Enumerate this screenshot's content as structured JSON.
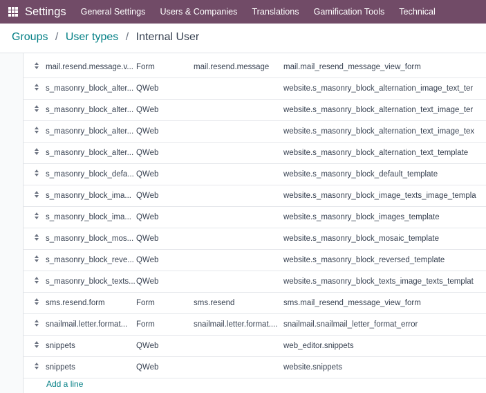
{
  "topbar": {
    "app_title": "Settings",
    "menu": [
      "General Settings",
      "Users & Companies",
      "Translations",
      "Gamification Tools",
      "Technical"
    ]
  },
  "breadcrumb": {
    "items": [
      "Groups",
      "User types",
      "Internal User"
    ],
    "separator": "/"
  },
  "table": {
    "rows": [
      {
        "name": "mail.resend.message.v...",
        "type": "Form",
        "model": "mail.resend.message",
        "key": "mail.mail_resend_message_view_form"
      },
      {
        "name": "s_masonry_block_alter...",
        "type": "QWeb",
        "model": "",
        "key": "website.s_masonry_block_alternation_image_text_ter"
      },
      {
        "name": "s_masonry_block_alter...",
        "type": "QWeb",
        "model": "",
        "key": "website.s_masonry_block_alternation_text_image_ter"
      },
      {
        "name": "s_masonry_block_alter...",
        "type": "QWeb",
        "model": "",
        "key": "website.s_masonry_block_alternation_text_image_tex"
      },
      {
        "name": "s_masonry_block_alter...",
        "type": "QWeb",
        "model": "",
        "key": "website.s_masonry_block_alternation_text_template"
      },
      {
        "name": "s_masonry_block_defa...",
        "type": "QWeb",
        "model": "",
        "key": "website.s_masonry_block_default_template"
      },
      {
        "name": "s_masonry_block_ima...",
        "type": "QWeb",
        "model": "",
        "key": "website.s_masonry_block_image_texts_image_templa"
      },
      {
        "name": "s_masonry_block_ima...",
        "type": "QWeb",
        "model": "",
        "key": "website.s_masonry_block_images_template"
      },
      {
        "name": "s_masonry_block_mos...",
        "type": "QWeb",
        "model": "",
        "key": "website.s_masonry_block_mosaic_template"
      },
      {
        "name": "s_masonry_block_reve...",
        "type": "QWeb",
        "model": "",
        "key": "website.s_masonry_block_reversed_template"
      },
      {
        "name": "s_masonry_block_texts...",
        "type": "QWeb",
        "model": "",
        "key": "website.s_masonry_block_texts_image_texts_templat"
      },
      {
        "name": "sms.resend.form",
        "type": "Form",
        "model": "sms.resend",
        "key": "sms.mail_resend_message_view_form"
      },
      {
        "name": "snailmail.letter.format...",
        "type": "Form",
        "model": "snailmail.letter.format....",
        "key": "snailmail.snailmail_letter_format_error"
      },
      {
        "name": "snippets",
        "type": "QWeb",
        "model": "",
        "key": "web_editor.snippets"
      },
      {
        "name": "snippets",
        "type": "QWeb",
        "model": "",
        "key": "website.snippets"
      }
    ],
    "add_line_label": "Add a line"
  },
  "colors": {
    "brand": "#714b67",
    "link": "#017e84",
    "text": "#374151",
    "border": "#e5e7eb"
  },
  "icons": {
    "apps": "apps-grid-icon",
    "handle": "drag-handle-icon"
  }
}
